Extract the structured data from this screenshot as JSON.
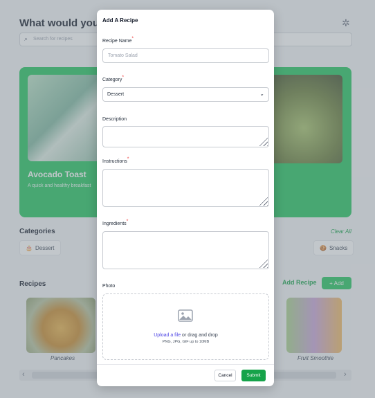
{
  "background": {
    "title": "What would you like",
    "search_placeholder": "Search for recipes",
    "hero": {
      "name": "Avocado Toast",
      "description": "A quick and healthy breakfast"
    },
    "categories_label": "Categories",
    "clear_all": "Clear All",
    "chips": [
      {
        "label": "Dessert",
        "icon": "cake-icon"
      },
      {
        "label": "Snacks",
        "icon": "snacks-icon"
      }
    ],
    "recipes_label": "Recipes",
    "add_recipe_link": "Add Recipe",
    "add_button": "+ Add",
    "cards": [
      {
        "label": "Pancakes"
      },
      {
        "label": "Fruit Smoothie"
      }
    ]
  },
  "modal": {
    "title": "Add A Recipe",
    "recipe_name": {
      "label": "Recipe Name",
      "placeholder": "Tomato Salad"
    },
    "category": {
      "label": "Category",
      "value": "Dessert"
    },
    "description": {
      "label": "Description",
      "value": ""
    },
    "instructions": {
      "label": "Instructions",
      "value": ""
    },
    "ingredients": {
      "label": "Ingredients",
      "value": ""
    },
    "photo": {
      "label": "Photo",
      "upload_link": "Upload a file",
      "upload_rest": " or drag and drop",
      "hint": "PNG, JPG, GIF up to 10MB"
    },
    "cancel_label": "Cancel",
    "submit_label": "Submit",
    "required_mark": "*"
  },
  "colors": {
    "accent": "#16a34a",
    "required": "#ef4444",
    "link": "#4f46e5"
  }
}
